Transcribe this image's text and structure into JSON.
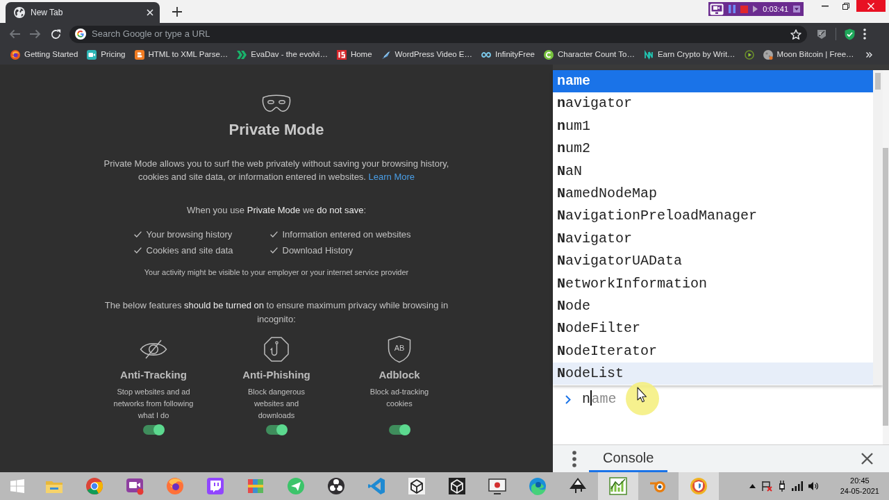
{
  "browser": {
    "tabs": [
      {
        "title": "New Tab",
        "selected": true
      }
    ],
    "recorder": {
      "time": "0:03:41"
    },
    "omnibox": {
      "placeholder": "Search Google or type a URL"
    },
    "bookmarks": [
      {
        "kind": "link",
        "label": "Getting Started"
      },
      {
        "kind": "link",
        "label": "Pricing"
      },
      {
        "kind": "link",
        "label": "HTML to XML Parse…"
      },
      {
        "kind": "link",
        "label": "EvaDav - the evolvi…"
      },
      {
        "kind": "link",
        "label": "Home"
      },
      {
        "kind": "link",
        "label": "WordPress Video E…"
      },
      {
        "kind": "link",
        "label": "InfinityFree"
      },
      {
        "kind": "link",
        "label": "Character Count To…"
      },
      {
        "kind": "link",
        "label": "Earn Crypto by Writ…"
      },
      {
        "kind": "icon"
      },
      {
        "kind": "link",
        "label": "Moon Bitcoin | Free…"
      }
    ]
  },
  "private_mode": {
    "title": "Private Mode",
    "intro": "Private Mode allows you to surf the web privately without saving your browsing history, cookies and site data, or information entered in websites.",
    "learn_more": "Learn More",
    "not_saved_heading": "When you use **Private Mode** we **do not save**:",
    "not_saved": [
      "Your browsing history",
      "Information entered on websites",
      "Cookies and site data",
      "Download History"
    ],
    "visibility_note": "Your activity might be visible to your employer or your internet service provider",
    "features_intro": "The below features **should be turned on** to ensure maximum privacy while browsing in incognito:",
    "features": [
      {
        "title": "Anti-Tracking",
        "description": "Stop websites and ad networks from following what I do",
        "on": true
      },
      {
        "title": "Anti-Phishing",
        "description": "Block dangerous websites and downloads",
        "on": true
      },
      {
        "title": "Adblock",
        "icon_text": "AB",
        "description": "Block ad-tracking cookies",
        "on": true
      }
    ]
  },
  "devtools": {
    "suggestions": [
      {
        "text": "**n**ame",
        "selected": true,
        "hovered": false
      },
      {
        "text": "**n**avigator",
        "selected": false,
        "hovered": false
      },
      {
        "text": "**n**um1",
        "selected": false,
        "hovered": false
      },
      {
        "text": "**n**um2",
        "selected": false,
        "hovered": false
      },
      {
        "text": "**N**aN",
        "selected": false,
        "hovered": false
      },
      {
        "text": "**N**amedNodeMap",
        "selected": false,
        "hovered": false
      },
      {
        "text": "**N**avigationPreloadManager",
        "selected": false,
        "hovered": false
      },
      {
        "text": "**N**avigator",
        "selected": false,
        "hovered": false
      },
      {
        "text": "**N**avigatorUAData",
        "selected": false,
        "hovered": false
      },
      {
        "text": "**N**etworkInformation",
        "selected": false,
        "hovered": false
      },
      {
        "text": "**N**ode",
        "selected": false,
        "hovered": false
      },
      {
        "text": "**N**odeFilter",
        "selected": false,
        "hovered": false
      },
      {
        "text": "**N**odeIterator",
        "selected": false,
        "hovered": false
      },
      {
        "text": "**N**odeList",
        "selected": false,
        "hovered": true
      }
    ],
    "prompt": {
      "value": "n",
      "completion": "ame"
    },
    "drawer_tabs": [
      {
        "label": "Console",
        "selected": true
      }
    ]
  },
  "taskbar": {
    "apps": [
      {
        "active": false
      },
      {
        "active": false
      },
      {
        "active": false
      },
      {
        "active": false
      },
      {
        "active": false
      },
      {
        "active": false
      },
      {
        "active": false
      },
      {
        "active": false
      },
      {
        "active": false
      },
      {
        "active": false
      },
      {
        "active": false
      },
      {
        "active": false
      },
      {
        "active": false
      },
      {
        "active": false
      },
      {
        "active": true
      },
      {
        "active": false
      },
      {
        "active": true
      }
    ],
    "clock": {
      "time": "20:45",
      "date": "24-05-2021"
    }
  }
}
